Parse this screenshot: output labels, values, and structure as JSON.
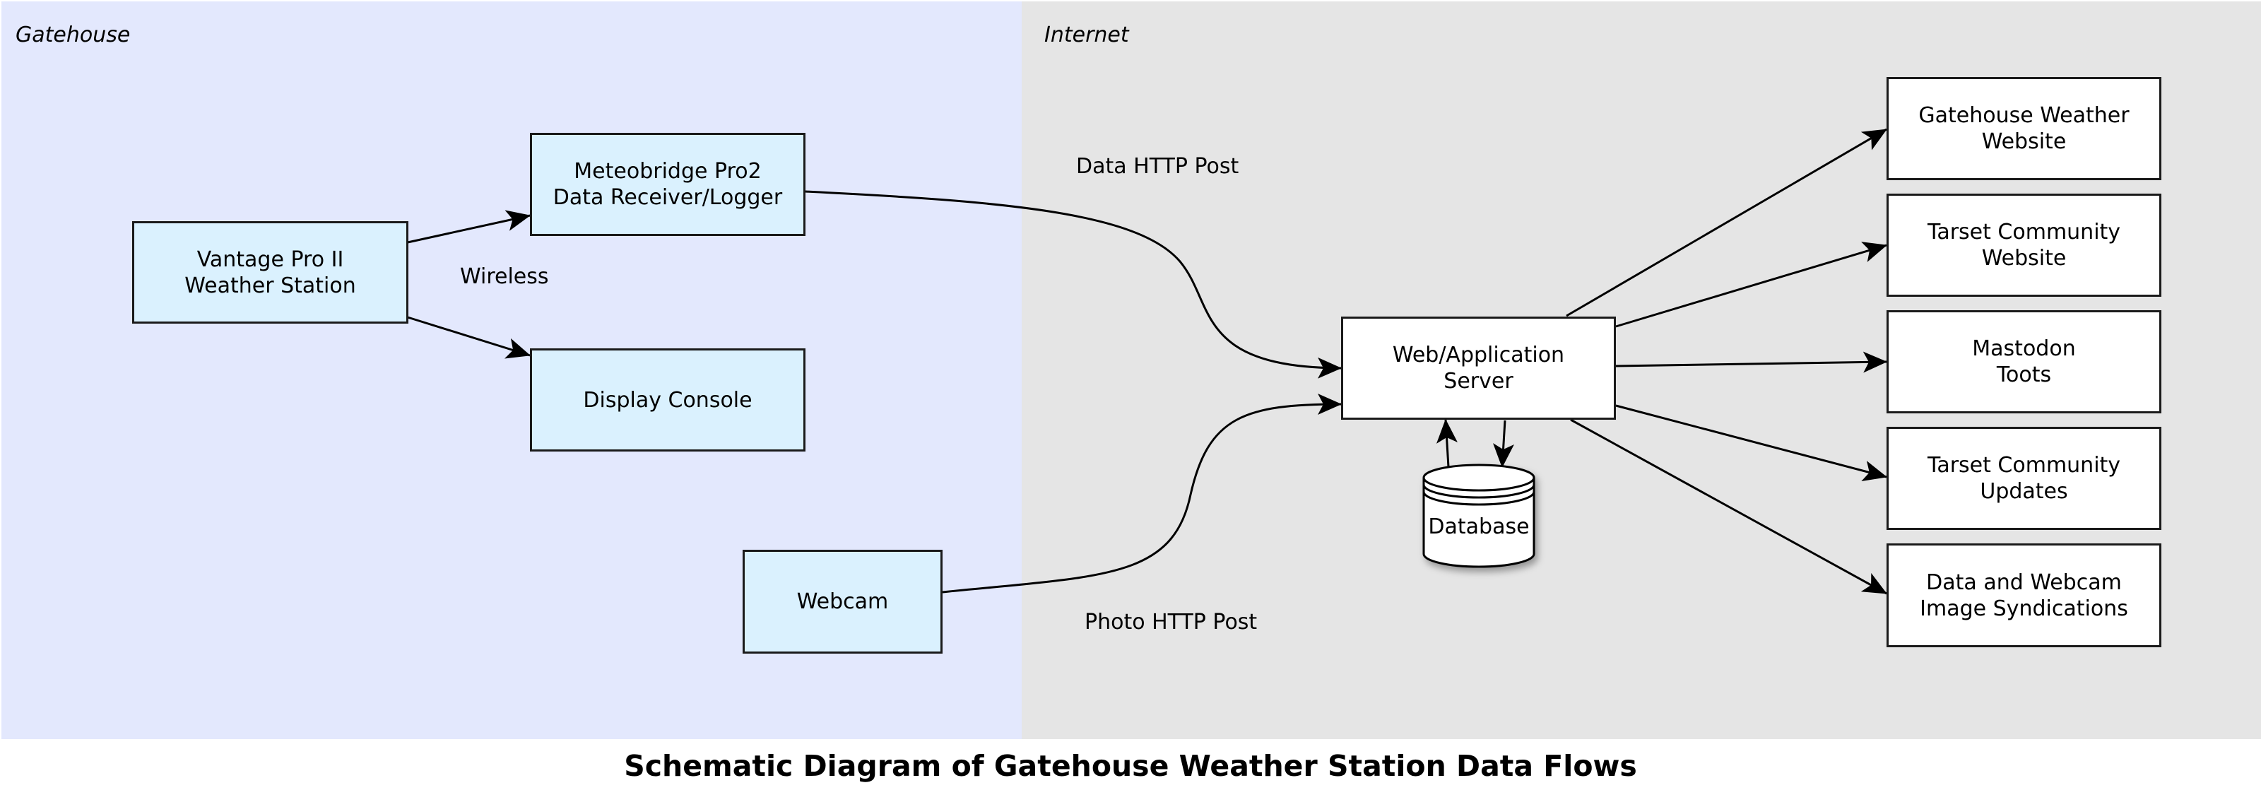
{
  "caption": "Schematic Diagram of Gatehouse Weather Station Data Flows",
  "zones": {
    "gatehouse": {
      "label": "Gatehouse",
      "color": "#e3e8fd"
    },
    "internet": {
      "label": "Internet",
      "color": "#e5e5e5"
    }
  },
  "nodes": {
    "vantage": "Vantage Pro II\nWeather Station",
    "meteobridge": "Meteobridge Pro2\nData Receiver/Logger",
    "console": "Display Console",
    "webcam": "Webcam",
    "server": "Web/Application\nServer",
    "database": "Database",
    "gatehouse_site": "Gatehouse Weather\nWebsite",
    "tarset_site": "Tarset Community\nWebsite",
    "mastodon": "Mastodon\nToots",
    "tarset_updates": "Tarset Community\nUpdates",
    "syndications": "Data and Webcam\nImage Syndications"
  },
  "edge_labels": {
    "wireless": "Wireless",
    "data_post": "Data HTTP Post",
    "photo_post": "Photo HTTP Post"
  },
  "edges": [
    {
      "from": "vantage",
      "to": "meteobridge",
      "label": "Wireless"
    },
    {
      "from": "vantage",
      "to": "console",
      "label": "Wireless"
    },
    {
      "from": "meteobridge",
      "to": "server",
      "label": "Data HTTP Post"
    },
    {
      "from": "webcam",
      "to": "server",
      "label": "Photo HTTP Post"
    },
    {
      "from": "database",
      "to": "server"
    },
    {
      "from": "server",
      "to": "database"
    },
    {
      "from": "server",
      "to": "gatehouse_site"
    },
    {
      "from": "server",
      "to": "tarset_site"
    },
    {
      "from": "server",
      "to": "mastodon"
    },
    {
      "from": "server",
      "to": "tarset_updates"
    },
    {
      "from": "server",
      "to": "syndications"
    }
  ],
  "colors": {
    "device_fill": "#daf1fe",
    "service_fill": "#ffffff",
    "stroke": "#1a1a1a"
  }
}
